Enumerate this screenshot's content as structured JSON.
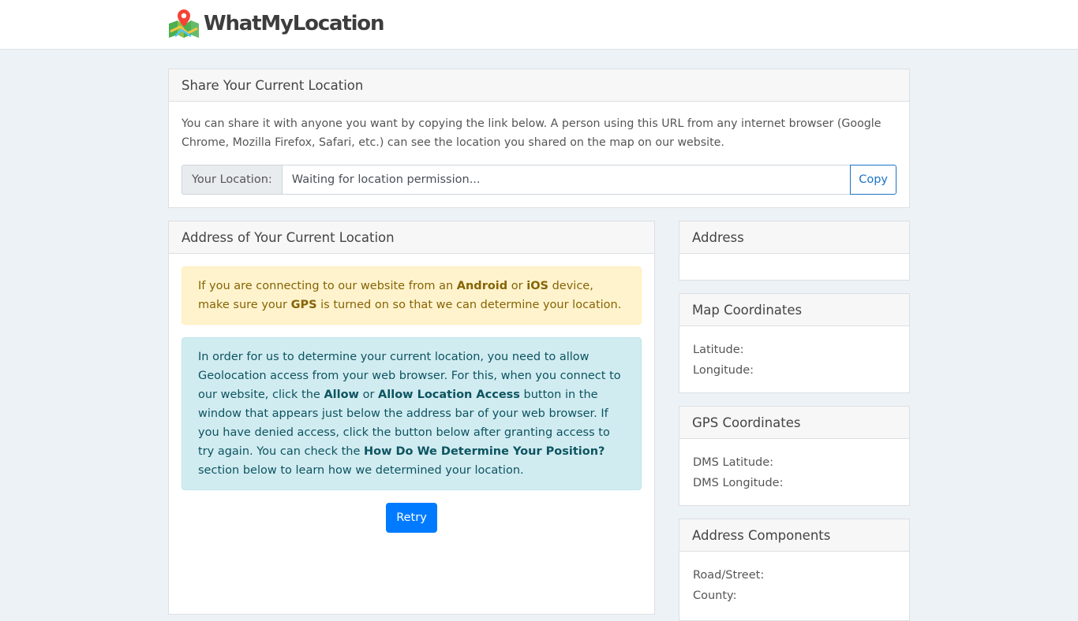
{
  "header": {
    "brand": "WhatMyLocation",
    "logo_icon": "map-pin-icon"
  },
  "share": {
    "title": "Share Your Current Location",
    "description": "You can share it with anyone you want by copying the link below. A person using this URL from any internet browser (Google Chrome, Mozilla Firefox, Safari, etc.) can see the location you shared on the map on our website.",
    "input_label": "Your Location:",
    "input_value": "Waiting for location permission...",
    "copy_label": "Copy"
  },
  "address_current": {
    "title": "Address of Your Current Location",
    "warning": {
      "t1": "If you are connecting to our website from an ",
      "b1": "Android",
      "t2": " or ",
      "b2": "iOS",
      "t3": " device, make sure your ",
      "b3": "GPS",
      "t4": " is turned on so that we can determine your location."
    },
    "info": {
      "t1": "In order for us to determine your current location, you need to allow Geolocation access from your web browser. For this, when you connect to our website, click the ",
      "b1": "Allow",
      "t2": " or ",
      "b2": "Allow Location Access",
      "t3": " button in the window that appears just below the address bar of your web browser. If you have denied access, click the button below after granting access to try again. You can check the ",
      "b3": "How Do We Determine Your Position?",
      "t4": " section below to learn how we determined your location."
    },
    "retry_label": "Retry"
  },
  "sidebar": {
    "address": {
      "title": "Address"
    },
    "map_coordinates": {
      "title": "Map Coordinates",
      "latitude_label": "Latitude:",
      "longitude_label": "Longitude:"
    },
    "gps_coordinates": {
      "title": "GPS Coordinates",
      "dms_latitude_label": "DMS Latitude:",
      "dms_longitude_label": "DMS Longitude:"
    },
    "address_components": {
      "title": "Address Components",
      "road_label": "Road/Street:",
      "county_label": "County:"
    }
  },
  "colors": {
    "primary": "#007bff",
    "background": "#edf2f7",
    "warning_bg": "#fff3cd",
    "info_bg": "#d1ecf1"
  }
}
